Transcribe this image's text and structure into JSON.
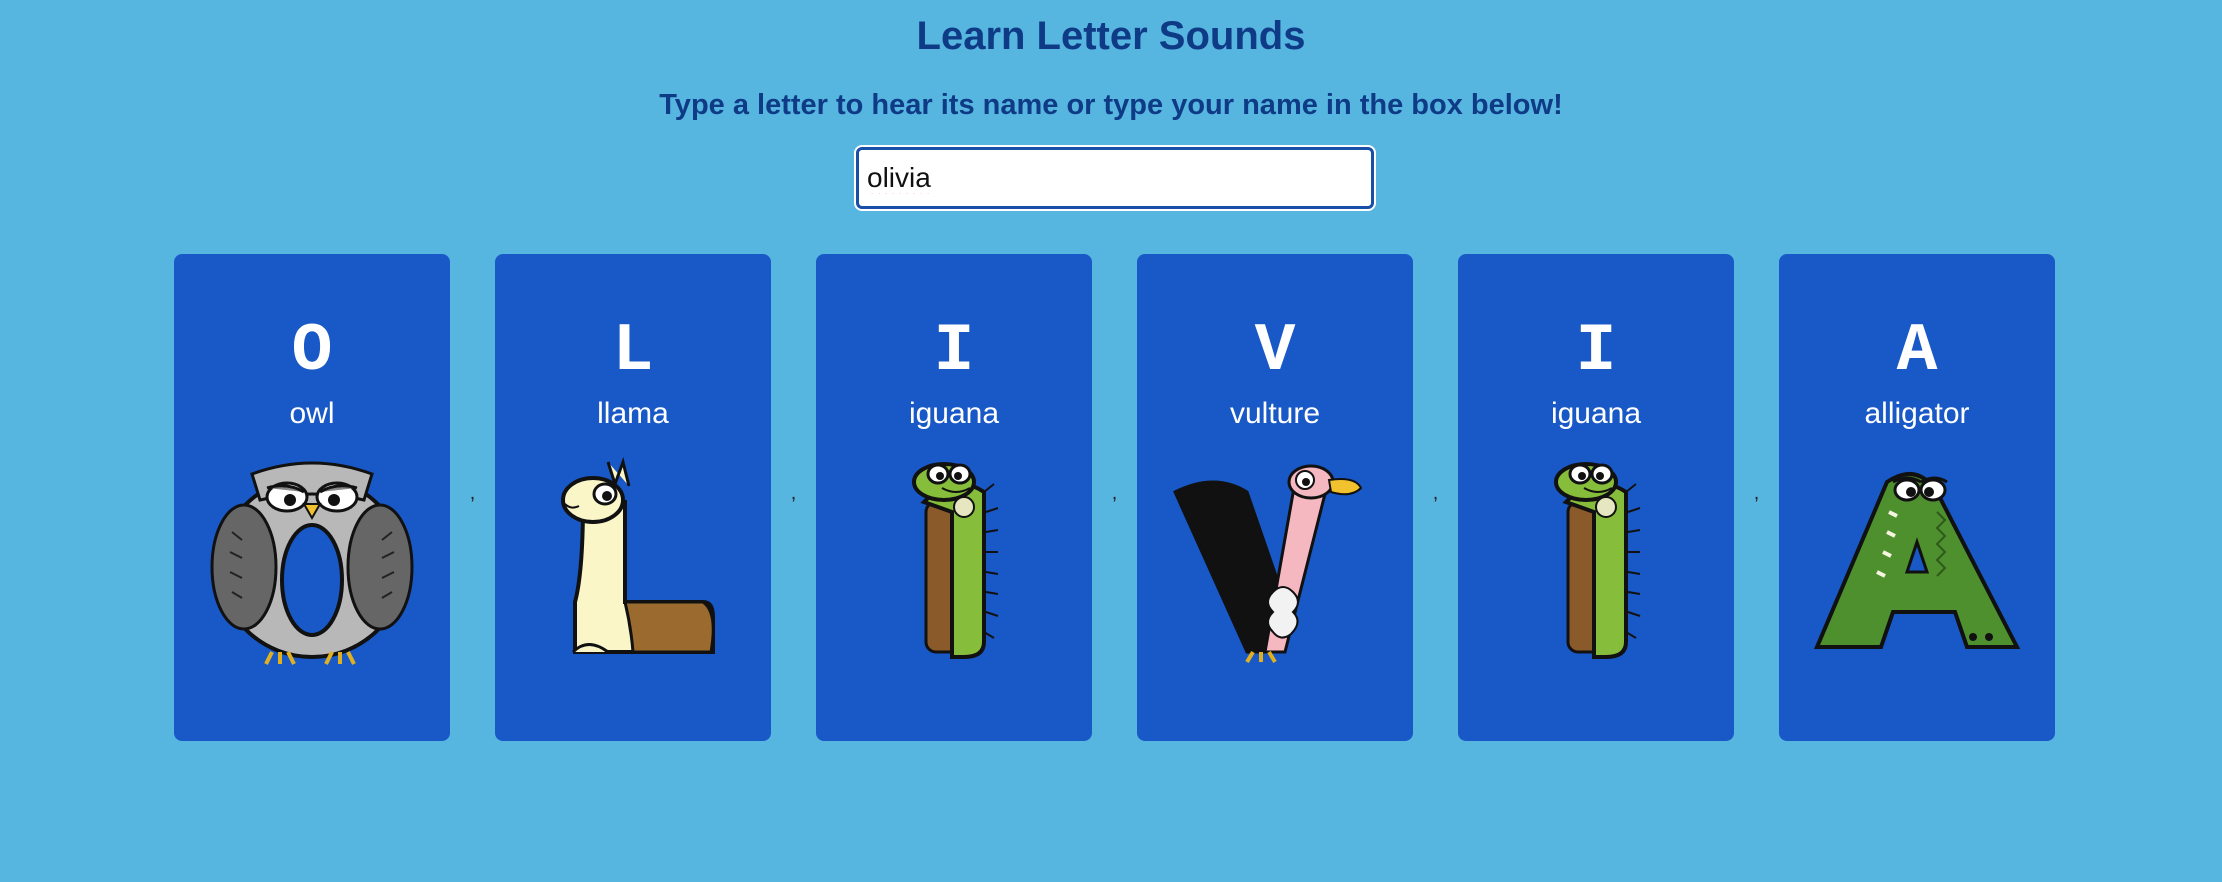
{
  "page": {
    "title": "Learn Letter Sounds",
    "instructions": "Type a letter to hear its name or type your name in the box below!"
  },
  "input": {
    "value": "olivia"
  },
  "separator": ",",
  "cards": [
    {
      "letter": "O",
      "word": "owl",
      "illustration": "owl-letter-o"
    },
    {
      "letter": "L",
      "word": "llama",
      "illustration": "llama-letter-l"
    },
    {
      "letter": "I",
      "word": "iguana",
      "illustration": "iguana-letter-i"
    },
    {
      "letter": "V",
      "word": "vulture",
      "illustration": "vulture-letter-v"
    },
    {
      "letter": "I",
      "word": "iguana",
      "illustration": "iguana-letter-i"
    },
    {
      "letter": "A",
      "word": "alligator",
      "illustration": "alligator-letter-a"
    }
  ],
  "colors": {
    "background": "#56b6e0",
    "card": "#1959c7",
    "heading": "#0e3a86"
  }
}
